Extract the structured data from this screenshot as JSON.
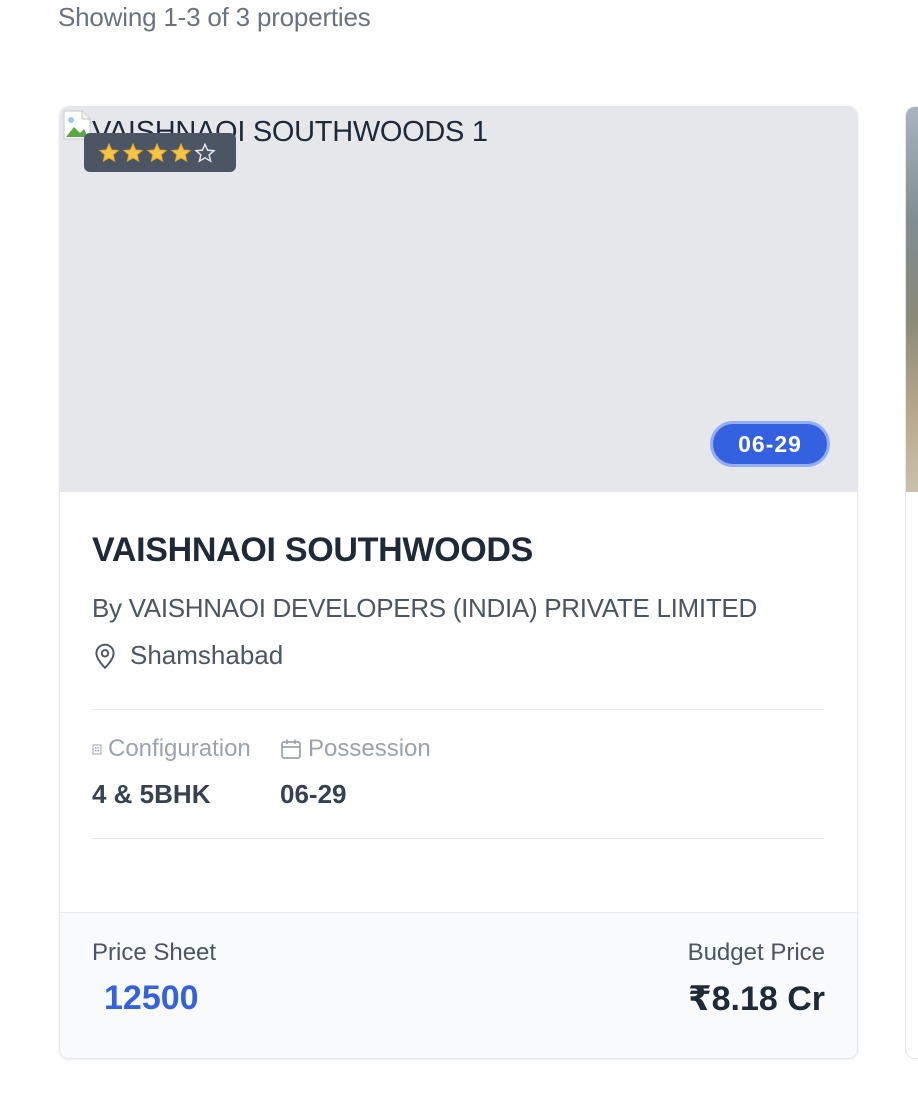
{
  "results": {
    "showing_text": "Showing 1-3 of 3 properties"
  },
  "property": {
    "image_alt": "VAISHNAOI SOUTHWOODS 1",
    "rating": 4,
    "rating_max": 5,
    "possession_badge": "06-29",
    "name": "VAISHNAOI SOUTHWOODS",
    "developer": "By VAISHNAOI DEVELOPERS (INDIA) PRIVATE LIMITED",
    "location": "Shamshabad",
    "configuration_label": "Configuration",
    "configuration_value": "4 & 5BHK",
    "possession_label": "Possession",
    "possession_value": "06-29",
    "price_sheet_label": "Price Sheet",
    "price_sheet_value": "12500",
    "budget_label": "Budget Price",
    "budget_value": "₹8.18 Cr"
  },
  "colors": {
    "accent": "#3461e0",
    "star_filled": "#f6c343",
    "star_empty_outline": "#e5e7eb"
  },
  "icons": {
    "location": "map-pin-icon",
    "configuration": "building-icon",
    "possession": "calendar-icon",
    "star": "star-icon"
  }
}
